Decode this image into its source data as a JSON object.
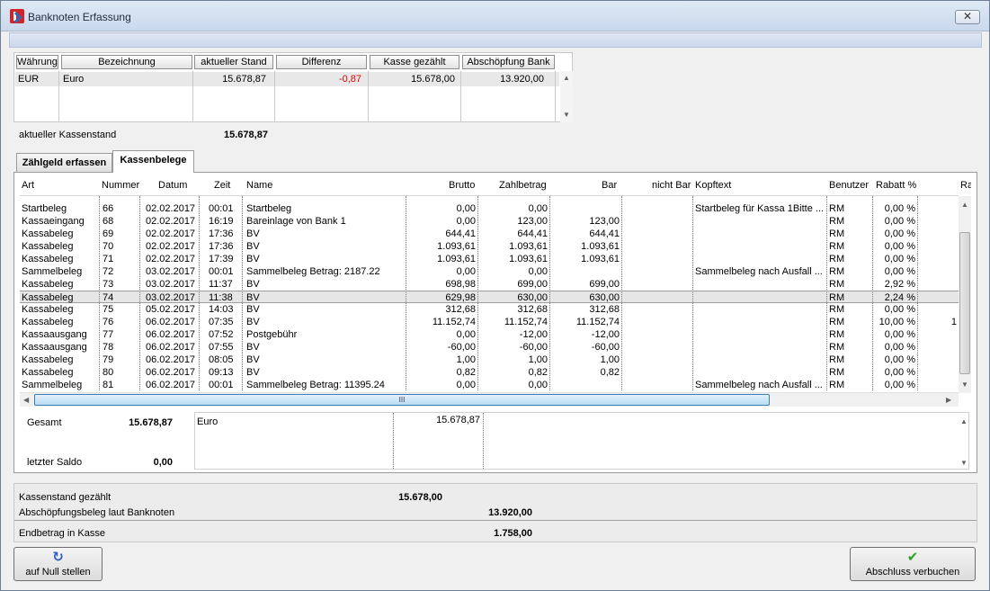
{
  "window": {
    "title": "Banknoten Erfassung",
    "close_symbol": "✕"
  },
  "currency_table": {
    "headers": [
      "Währung",
      "Bezeichnung",
      "aktueller Stand",
      "Differenz",
      "Kasse gezählt",
      "Abschöpfung Bank"
    ],
    "row": {
      "waehrung": "EUR",
      "bezeichnung": "Euro",
      "stand": "15.678,87",
      "differenz": "-0,87",
      "gezaehlt": "15.678,00",
      "abschoepfung": "13.920,00"
    }
  },
  "kassenstand": {
    "label": "aktueller Kassenstand",
    "value": "15.678,87"
  },
  "tabs": [
    {
      "label": "Zählgeld erfassen"
    },
    {
      "label": "Kassenbelege"
    }
  ],
  "belege": {
    "headers": [
      "Art",
      "Nummer",
      "Datum",
      "Zeit",
      "Name",
      "Brutto",
      "Zahlbetrag",
      "Bar",
      "nicht Bar",
      "Kopftext",
      "Benutzer",
      "Rabatt %",
      "Ra"
    ],
    "rows": [
      {
        "art": "Startbeleg",
        "nummer": "66",
        "datum": "02.02.2017",
        "zeit": "00:01",
        "name": "Startbeleg",
        "brutto": "0,00",
        "zahlbetrag": "0,00",
        "bar": "",
        "nicht_bar": "",
        "kopftext": "Startbeleg für Kassa 1Bitte ...",
        "benutzer": "RM",
        "rabatt": "0,00 %",
        "ra": ""
      },
      {
        "art": "Kassaeingang",
        "nummer": "68",
        "datum": "02.02.2017",
        "zeit": "16:19",
        "name": "Bareinlage von Bank 1",
        "brutto": "0,00",
        "zahlbetrag": "123,00",
        "bar": "123,00",
        "nicht_bar": "",
        "kopftext": "",
        "benutzer": "RM",
        "rabatt": "0,00 %",
        "ra": ""
      },
      {
        "art": "Kassabeleg",
        "nummer": "69",
        "datum": "02.02.2017",
        "zeit": "17:36",
        "name": "BV",
        "brutto": "644,41",
        "zahlbetrag": "644,41",
        "bar": "644,41",
        "nicht_bar": "",
        "kopftext": "",
        "benutzer": "RM",
        "rabatt": "0,00 %",
        "ra": ""
      },
      {
        "art": "Kassabeleg",
        "nummer": "70",
        "datum": "02.02.2017",
        "zeit": "17:36",
        "name": "BV",
        "brutto": "1.093,61",
        "zahlbetrag": "1.093,61",
        "bar": "1.093,61",
        "nicht_bar": "",
        "kopftext": "",
        "benutzer": "RM",
        "rabatt": "0,00 %",
        "ra": ""
      },
      {
        "art": "Kassabeleg",
        "nummer": "71",
        "datum": "02.02.2017",
        "zeit": "17:39",
        "name": "BV",
        "brutto": "1.093,61",
        "zahlbetrag": "1.093,61",
        "bar": "1.093,61",
        "nicht_bar": "",
        "kopftext": "",
        "benutzer": "RM",
        "rabatt": "0,00 %",
        "ra": ""
      },
      {
        "art": "Sammelbeleg",
        "nummer": "72",
        "datum": "03.02.2017",
        "zeit": "00:01",
        "name": "Sammelbeleg Betrag: 2187.22",
        "brutto": "0,00",
        "zahlbetrag": "0,00",
        "bar": "",
        "nicht_bar": "",
        "kopftext": "Sammelbeleg nach Ausfall ...",
        "benutzer": "RM",
        "rabatt": "0,00 %",
        "ra": ""
      },
      {
        "art": "Kassabeleg",
        "nummer": "73",
        "datum": "03.02.2017",
        "zeit": "11:37",
        "name": "BV",
        "brutto": "698,98",
        "zahlbetrag": "699,00",
        "bar": "699,00",
        "nicht_bar": "",
        "kopftext": "",
        "benutzer": "RM",
        "rabatt": "2,92 %",
        "ra": ""
      },
      {
        "art": "Kassabeleg",
        "nummer": "74",
        "datum": "03.02.2017",
        "zeit": "11:38",
        "name": "BV",
        "brutto": "629,98",
        "zahlbetrag": "630,00",
        "bar": "630,00",
        "nicht_bar": "",
        "kopftext": "",
        "benutzer": "RM",
        "rabatt": "2,24 %",
        "ra": ""
      },
      {
        "art": "Kassabeleg",
        "nummer": "75",
        "datum": "05.02.2017",
        "zeit": "14:03",
        "name": "BV",
        "brutto": "312,68",
        "zahlbetrag": "312,68",
        "bar": "312,68",
        "nicht_bar": "",
        "kopftext": "",
        "benutzer": "RM",
        "rabatt": "0,00 %",
        "ra": ""
      },
      {
        "art": "Kassabeleg",
        "nummer": "76",
        "datum": "06.02.2017",
        "zeit": "07:35",
        "name": "BV",
        "brutto": "11.152,74",
        "zahlbetrag": "11.152,74",
        "bar": "11.152,74",
        "nicht_bar": "",
        "kopftext": "",
        "benutzer": "RM",
        "rabatt": "10,00 %",
        "ra": "1"
      },
      {
        "art": "Kassaausgang",
        "nummer": "77",
        "datum": "06.02.2017",
        "zeit": "07:52",
        "name": "Postgebühr",
        "brutto": "0,00",
        "zahlbetrag": "-12,00",
        "bar": "-12,00",
        "nicht_bar": "",
        "kopftext": "",
        "benutzer": "RM",
        "rabatt": "0,00 %",
        "ra": ""
      },
      {
        "art": "Kassaausgang",
        "nummer": "78",
        "datum": "06.02.2017",
        "zeit": "07:55",
        "name": "BV",
        "brutto": "-60,00",
        "zahlbetrag": "-60,00",
        "bar": "-60,00",
        "nicht_bar": "",
        "kopftext": "",
        "benutzer": "RM",
        "rabatt": "0,00 %",
        "ra": ""
      },
      {
        "art": "Kassabeleg",
        "nummer": "79",
        "datum": "06.02.2017",
        "zeit": "08:05",
        "name": "BV",
        "brutto": "1,00",
        "zahlbetrag": "1,00",
        "bar": "1,00",
        "nicht_bar": "",
        "kopftext": "",
        "benutzer": "RM",
        "rabatt": "0,00 %",
        "ra": ""
      },
      {
        "art": "Kassabeleg",
        "nummer": "80",
        "datum": "06.02.2017",
        "zeit": "09:13",
        "name": "BV",
        "brutto": "0,82",
        "zahlbetrag": "0,82",
        "bar": "0,82",
        "nicht_bar": "",
        "kopftext": "",
        "benutzer": "RM",
        "rabatt": "0,00 %",
        "ra": ""
      },
      {
        "art": "Sammelbeleg",
        "nummer": "81",
        "datum": "06.02.2017",
        "zeit": "00:01",
        "name": "Sammelbeleg Betrag: 11395.24",
        "brutto": "0,00",
        "zahlbetrag": "0,00",
        "bar": "",
        "nicht_bar": "",
        "kopftext": "Sammelbeleg nach Ausfall ...",
        "benutzer": "RM",
        "rabatt": "0,00 %",
        "ra": ""
      }
    ],
    "selected_index": 7,
    "hscroll_grip": "III"
  },
  "summary": {
    "gesamt_label": "Gesamt",
    "gesamt_value": "15.678,87",
    "saldo_label": "letzter Saldo",
    "saldo_value": "0,00",
    "currency_name": "Euro",
    "currency_amount": "15.678,87"
  },
  "bottom": {
    "gezaehlt_label": "Kassenstand gezählt",
    "gezaehlt_value": "15.678,00",
    "abschoepf_label": "Abschöpfungsbeleg laut Banknoten",
    "abschoepf_value": "13.920,00",
    "end_label": "Endbetrag in Kasse",
    "end_value": "1.758,00"
  },
  "buttons": {
    "reset": {
      "label": "auf Null stellen",
      "icon": "reset-arrow-icon"
    },
    "finish": {
      "label": "Abschluss verbuchen",
      "icon": "checkmark-icon"
    }
  },
  "colors": {
    "negative": "#e00000",
    "check": "#27a327",
    "reset_icon": "#2a5fd0"
  }
}
